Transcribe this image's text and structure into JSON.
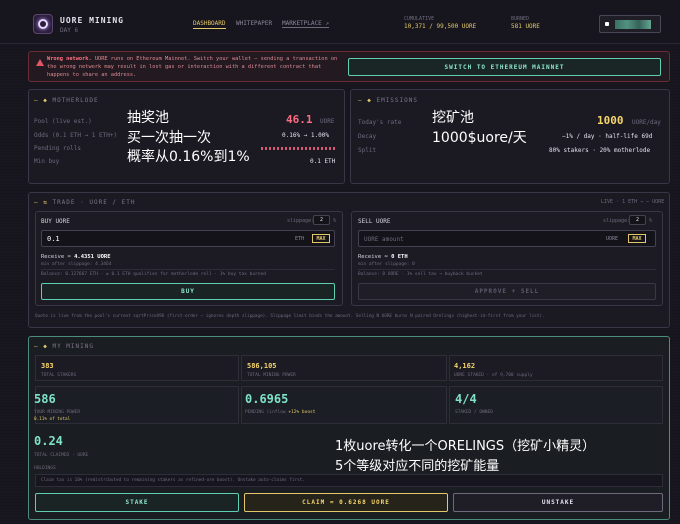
{
  "header": {
    "app_title": "UORE MINING",
    "day_label": "DAY 6",
    "nav": [
      "DASHBOARD",
      "WHITEPAPER",
      "MARKETPLACE ↗"
    ],
    "cumulative_label": "CUMULATIVE",
    "cumulative_value": "10,371 / 99,500 UORE",
    "burned_label": "BURNED",
    "burned_value": "581 UORE"
  },
  "warning": {
    "text_bold": "Wrong network.",
    "text": " UORE runs on Ethereum Mainnet. Switch your wallet — sending a transaction on the wrong network may result in lost gas or interaction with a different contract that happens to share an address.",
    "button": "SWITCH TO ETHEREUM MAINNET"
  },
  "motherlode": {
    "title": "MOTHERLODE",
    "rows": [
      {
        "label": "Pool (live est.)",
        "value": "46.1",
        "unit": "UORE"
      },
      {
        "label": "Odds (0.1 ETH → 1 ETH+)",
        "value": "0.16% → 1.00%"
      },
      {
        "label": "Pending rolls",
        "value": ""
      },
      {
        "label": "Min buy",
        "value": "0.1 ETH"
      }
    ],
    "note_cn": [
      "抽奖池",
      "买一次抽一次",
      "概率从0.16%到1%"
    ]
  },
  "emissions": {
    "title": "EMISSIONS",
    "rows": [
      {
        "label": "Today's rate",
        "value": "1000",
        "unit": "UORE/day"
      },
      {
        "label": "Decay",
        "value": "−1% / day · half-life 69d"
      },
      {
        "label": "Split",
        "value": "80% stakers · 20% motherlode"
      }
    ],
    "note_cn": [
      "挖矿池",
      "1000$uore/天"
    ]
  },
  "trade": {
    "title": "TRADE · UORE / ETH",
    "right": "LIVE · 1 ETH → ― UORE",
    "buy": {
      "title": "BUY UORE",
      "slippage_label": "slippage:",
      "slippage_value": "2",
      "pct": "%",
      "amount": "0.1",
      "unit": "ETH",
      "max": "MAX",
      "receive_label": "Receive ≈",
      "receive_value": "4.4351 UORE",
      "min_after": "min after slippage: 4.3464",
      "balance": "Balance: 0.127667 ETH · ≥ 0.1 ETH qualifies for motherlode roll · 1% buy tax burned",
      "button": "BUY"
    },
    "sell": {
      "title": "SELL UORE",
      "slippage_label": "slippage:",
      "slippage_value": "2",
      "pct": "%",
      "placeholder": "UORE amount",
      "unit": "UORE",
      "max": "MAX",
      "receive_label": "Receive ≈",
      "receive_value": "0 ETH",
      "min_after": "min after slippage: 0",
      "balance": "Balance: 0 UORE · 1% sell tax → buyback bucket",
      "button": "APPROVE + SELL"
    },
    "footnote": "Quote is live from the pool's current sqrtPriceX96 (first-order — ignores depth slippage). Slippage limit binds the amount. Selling N UORE burns N paired Orelings (highest-id-first from your list)."
  },
  "mining": {
    "title": "MY MINING",
    "stats": [
      {
        "value": "383",
        "label": "TOTAL STAKERS"
      },
      {
        "value": "586,105",
        "label": "TOTAL MINING POWER"
      },
      {
        "value": "4,162",
        "label": "UORE STAKED",
        "extra": "· of 9,700 supply"
      }
    ],
    "big": [
      {
        "value": "586",
        "label": "YOUR MINING POWER",
        "sub": "0.11% of total"
      },
      {
        "value": "0.6965",
        "label": "PENDING (inflow",
        "extra": "+12% boost"
      },
      {
        "value": "4/4",
        "label": "STAKED / OWNED"
      }
    ],
    "claimed_value": "0.24",
    "claimed_label": "TOTAL CLAIMED · UORE",
    "holdings_label": "HOLDINGS",
    "holdings_text": "Claim tax is 10% (redistributed to remaining stakers as refined-ore boost). Unstake auto-claims first.",
    "buttons": [
      "STAKE",
      "CLAIM ≈ 0.6268 UORE",
      "UNSTAKE"
    ],
    "note_cn": [
      "1枚uore转化一个ORELINGS（挖矿小精灵）",
      "5个等级对应不同的挖矿能量"
    ]
  }
}
